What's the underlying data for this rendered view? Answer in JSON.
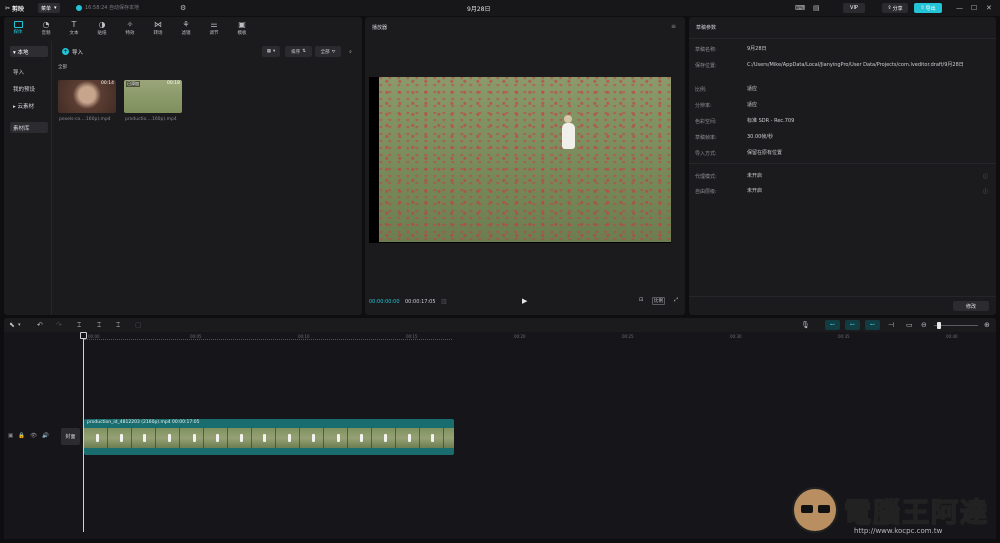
{
  "titlebar": {
    "app_name": "剪映",
    "menu_label": "菜单",
    "autosave": "16:58:24 自动保存本地",
    "title": "9月28日",
    "vip_label": "VIP",
    "share_label": "分享",
    "export_label": "导出"
  },
  "media_tools": [
    {
      "label": "媒体",
      "icon": "media-icon"
    },
    {
      "label": "音频",
      "icon": "audio-icon"
    },
    {
      "label": "文本",
      "icon": "text-icon"
    },
    {
      "label": "贴纸",
      "icon": "sticker-icon"
    },
    {
      "label": "特效",
      "icon": "effects-icon"
    },
    {
      "label": "转场",
      "icon": "transition-icon"
    },
    {
      "label": "滤镜",
      "icon": "filter-icon"
    },
    {
      "label": "调节",
      "icon": "adjust-icon"
    },
    {
      "label": "模板",
      "icon": "template-icon"
    }
  ],
  "media_sidebar": {
    "local": "▾ 本地",
    "import": "导入",
    "presets": "我的预设",
    "cloud": "▸ 云素材",
    "library": "素材库"
  },
  "media_main": {
    "import_label": "导入",
    "sort_label": "排序",
    "filter_label": "全部",
    "all_label": "全部",
    "items": [
      {
        "name": "pexels-co....160p).mp4",
        "duration": "00:14",
        "added": ""
      },
      {
        "name": "productio....160p).mp4",
        "duration": "00:18",
        "added": "已添加"
      }
    ]
  },
  "player": {
    "title": "播放器",
    "current_time": "00:00:00:00",
    "total_time": "00:00:17:05",
    "ratio_label": "比例"
  },
  "props": {
    "title": "草稿参数",
    "rows": [
      {
        "key": "草稿名称:",
        "value": "9月28日"
      },
      {
        "key": "保存位置:",
        "value": "C:/Users/Mike/AppData/Local/JianyingPro/User Data/Projects/com.lveditor.draft/9月28日"
      },
      {
        "key": "比例:",
        "value": "适应"
      },
      {
        "key": "分辨率:",
        "value": "适应"
      },
      {
        "key": "色彩空间:",
        "value": "标准 SDR - Rec.709"
      },
      {
        "key": "草稿帧率:",
        "value": "30.00帧/秒"
      },
      {
        "key": "导入方式:",
        "value": "保留在原有位置"
      }
    ],
    "rows2": [
      {
        "key": "代理模式:",
        "value": "未开启"
      },
      {
        "key": "自由层级:",
        "value": "未开启"
      }
    ],
    "modify_label": "修改"
  },
  "timeline": {
    "ruler_labels": [
      "00:00",
      "00:05",
      "00:10",
      "00:15",
      "00:20",
      "00:25",
      "00:30",
      "00:35",
      "00:40"
    ],
    "cover_label": "封面",
    "clip_label": "production_id_4812203 (2160p).mp4",
    "clip_duration": "00:00:17:05"
  },
  "watermark": {
    "text": "電腦王阿達",
    "url": "http://www.kocpc.com.tw"
  }
}
